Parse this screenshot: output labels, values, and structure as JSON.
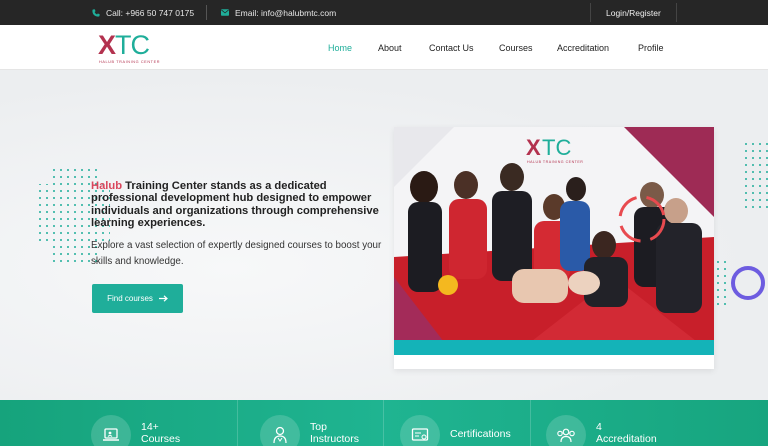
{
  "topbar": {
    "phone": "Call: +966 50 747 0175",
    "email": "Email: info@halubmtc.com",
    "login": "Login/Register"
  },
  "logo": {
    "x": "X",
    "tc": "TC",
    "subtitle": "HALUB TRAINING CENTER"
  },
  "nav": {
    "home": "Home",
    "about": "About",
    "contact": "Contact Us",
    "courses": "Courses",
    "accreditation": "Accreditation",
    "profile": "Profile"
  },
  "hero": {
    "brand": "Halub",
    "title_rest": " Training Center stands as a dedicated professional development hub designed to empower individuals and organizations through comprehensive learning experiences.",
    "description": "Explore a vast selection of expertly designed courses to boost your skills and knowledge.",
    "button": "Find courses",
    "photo_logo": "XTC",
    "photo_logo_sub": "HALUB TRAINING CENTER"
  },
  "stats": [
    {
      "line1": "14+",
      "line2": "Courses",
      "icon": "laptop-icon"
    },
    {
      "line1": "Top",
      "line2": "Instructors",
      "icon": "instructor-icon"
    },
    {
      "line1": "Certifications",
      "line2": "",
      "icon": "certificate-icon"
    },
    {
      "line1": "4",
      "line2": "Accreditation",
      "icon": "group-icon"
    }
  ],
  "colors": {
    "accent": "#1fae9a",
    "brand": "#d9465c",
    "topbar": "#262626",
    "stats_bar": "#1aab88"
  }
}
